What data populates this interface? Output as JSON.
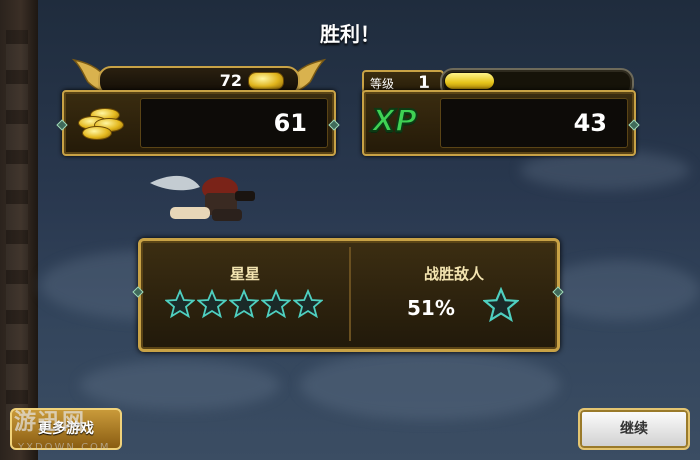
{
  "header": {
    "title": "胜利！"
  },
  "gold": {
    "earned": "72",
    "total": "61"
  },
  "level": {
    "label": "等级",
    "value": "1",
    "progress": 0.27,
    "xp_label": "XP",
    "xp_total": "43"
  },
  "results": {
    "stars": {
      "heading": "星星",
      "filled": 0,
      "count": 5
    },
    "enemies": {
      "heading": "战胜敌人",
      "percent": "51%"
    }
  },
  "buttons": {
    "more": "更多游戏",
    "continue": "继续"
  },
  "watermark": {
    "text": "游迅网",
    "sub": "YXDOWN.COM"
  },
  "colors": {
    "gold_border": "#c8a246",
    "star_outline": "#4fd0c0",
    "xp_green": "#3fd154",
    "bar_fill": "#e5c41a"
  }
}
